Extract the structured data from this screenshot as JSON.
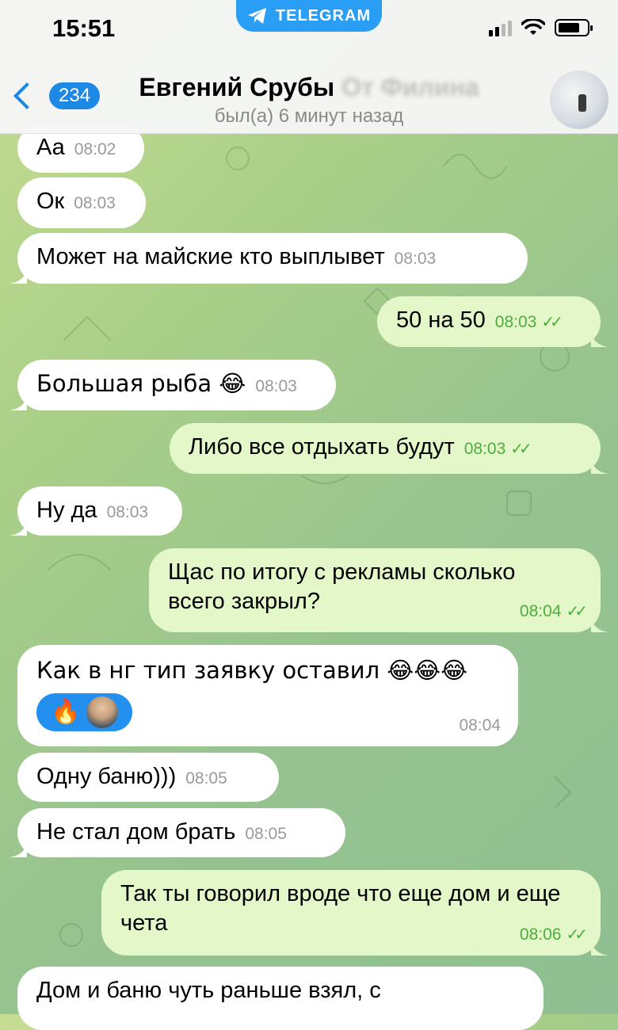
{
  "status_bar": {
    "time": "15:51",
    "pill_label": "TELEGRAM"
  },
  "header": {
    "back_count": "234",
    "title_visible": "Евгений Срубы",
    "title_obscured": "От Филина",
    "subtitle": "был(а) 6 минут назад"
  },
  "messages": [
    {
      "dir": "in",
      "text": "Аа",
      "time": "08:02"
    },
    {
      "dir": "in",
      "text": "Ок",
      "time": "08:03"
    },
    {
      "dir": "in",
      "text": "Может на майские кто выплывет",
      "time": "08:03"
    },
    {
      "dir": "out",
      "text": "50 на 50",
      "time": "08:03"
    },
    {
      "dir": "in",
      "text": "Большая рыба 😂",
      "time": "08:03"
    },
    {
      "dir": "out",
      "text": "Либо все отдыхать будут",
      "time": "08:03"
    },
    {
      "dir": "in",
      "text": "Ну да",
      "time": "08:03"
    },
    {
      "dir": "out",
      "text": "Щас по итогу с рекламы сколько всего закрыл?",
      "time": "08:04"
    },
    {
      "dir": "in",
      "text": "Как в нг тип заявку оставил 😂😂😂",
      "time": "08:04",
      "reaction": "🔥"
    },
    {
      "dir": "in",
      "text": "Одну баню)))",
      "time": "08:05"
    },
    {
      "dir": "in",
      "text": "Не стал дом брать",
      "time": "08:05"
    },
    {
      "dir": "out",
      "text": "Так ты говорил вроде что еще дом и еще чета",
      "time": "08:06"
    },
    {
      "dir": "in",
      "text": "Дом и баню чуть раньше взял, с",
      "time": ""
    }
  ],
  "colors": {
    "accent": "#1e88e5",
    "outgoing_bubble": "#e3f7c8",
    "incoming_bubble": "#ffffff",
    "read_ticks": "#4cae3d"
  },
  "icons": {
    "back": "chevron-left-icon",
    "telegram": "paper-plane-icon",
    "read": "double-check-icon"
  }
}
